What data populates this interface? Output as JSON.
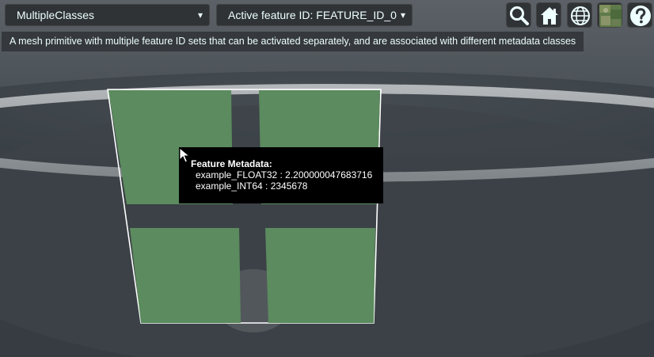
{
  "toolbar": {
    "class_select": {
      "selected": "MultipleClasses"
    },
    "feature_id_select": {
      "selected": "Active feature ID: FEATURE_ID_0"
    },
    "description": "A mesh primitive with multiple feature ID sets that can be activated separately, and are associated with different metadata classes",
    "buttons": {
      "search_icon": "search-icon",
      "home_icon": "home-icon",
      "globe_icon": "globe-icon",
      "imagery_icon": "imagery-thumbnail",
      "help_icon": "help-icon"
    }
  },
  "tooltip": {
    "heading": "Feature Metadata:",
    "rows": [
      "example_FLOAT32 : 2.200000047683716",
      "example_INT64 : 2345678"
    ]
  },
  "colors": {
    "feature_green": "#5b8b5e",
    "panel_bg": "#303336",
    "panel_text": "#edffff",
    "tooltip_bg": "#000000",
    "background_gray": "#3a4045"
  }
}
